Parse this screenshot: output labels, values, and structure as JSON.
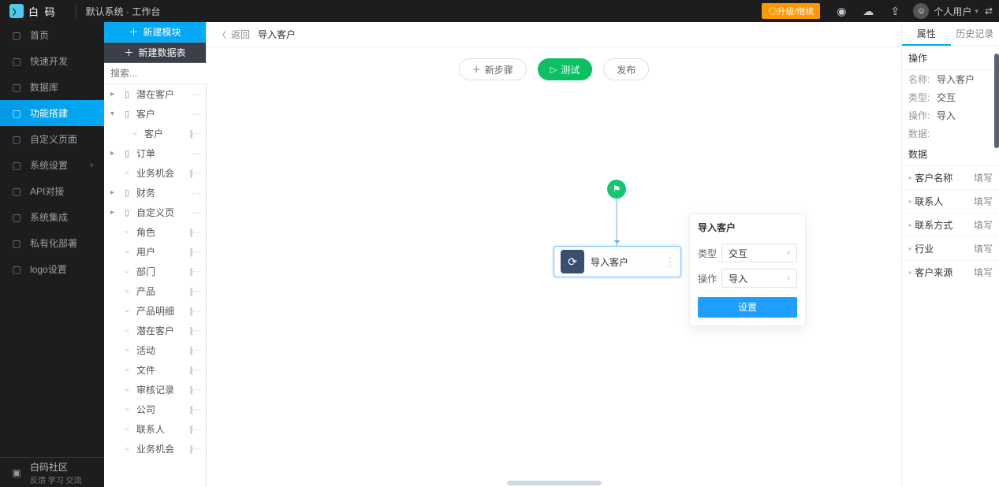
{
  "header": {
    "brand": "白 码",
    "system": "默认系统",
    "dot": "·",
    "workspace": "工作台",
    "upgrade": "◎升级/继续",
    "user": "个人用户"
  },
  "leftnav": {
    "items": [
      {
        "label": "首页",
        "icon": "home-icon"
      },
      {
        "label": "快速开发",
        "icon": "cube-icon"
      },
      {
        "label": "数据库",
        "icon": "database-icon"
      },
      {
        "label": "功能搭建",
        "icon": "module-icon",
        "active": true
      },
      {
        "label": "自定义页面",
        "icon": "page-icon"
      },
      {
        "label": "系统设置",
        "icon": "settings-icon",
        "chev": true
      },
      {
        "label": "API对接",
        "icon": "api-icon"
      },
      {
        "label": "系统集成",
        "icon": "integration-icon"
      },
      {
        "label": "私有化部署",
        "icon": "deploy-icon"
      },
      {
        "label": "logo设置",
        "icon": "logo-icon"
      }
    ],
    "community": {
      "title": "白码社区",
      "sub": "反馈 学习 交流"
    }
  },
  "treepanel": {
    "btn_new_module": "新建模块",
    "btn_new_table": "新建数据表",
    "search_placeholder": "搜索...",
    "rows": [
      {
        "type": "folder",
        "label": "潜在客户",
        "dots": true
      },
      {
        "type": "folder",
        "label": "客户",
        "expanded": true,
        "dots": true
      },
      {
        "type": "leaf",
        "label": "客户",
        "child": true,
        "bars": true
      },
      {
        "type": "folder",
        "label": "订单",
        "dots": true
      },
      {
        "type": "leaf",
        "label": "业务机会",
        "bars": true
      },
      {
        "type": "folder",
        "label": "财务",
        "dots": true
      },
      {
        "type": "folder",
        "label": "自定义页",
        "dots": true
      },
      {
        "type": "leaf",
        "label": "角色",
        "bars": true
      },
      {
        "type": "leaf",
        "label": "用户",
        "bars": true
      },
      {
        "type": "leaf",
        "label": "部门",
        "bars": true
      },
      {
        "type": "leaf",
        "label": "产品",
        "bars": true
      },
      {
        "type": "leaf",
        "label": "产品明细",
        "bars": true
      },
      {
        "type": "leaf",
        "label": "潜在客户",
        "bars": true
      },
      {
        "type": "leaf",
        "label": "活动",
        "bars": true
      },
      {
        "type": "leaf",
        "label": "文件",
        "bars": true
      },
      {
        "type": "leaf",
        "label": "审核记录",
        "bars": true
      },
      {
        "type": "leaf",
        "label": "公司",
        "bars": true
      },
      {
        "type": "leaf",
        "label": "联系人",
        "bars": true
      },
      {
        "type": "leaf",
        "label": "业务机会",
        "bars": true
      }
    ]
  },
  "breadcrumb": {
    "back": "返回",
    "title": "导入客户"
  },
  "toolbar": {
    "new_step": "新步骤",
    "test": "测试",
    "publish": "发布"
  },
  "flow": {
    "node": {
      "label": "导入客户"
    },
    "popup": {
      "title": "导入客户",
      "type_label": "类型",
      "type_value": "交互",
      "op_label": "操作",
      "op_value": "导入",
      "settings": "设置"
    }
  },
  "rightpanel": {
    "tab1": "属性",
    "tab2": "历史记录",
    "section_op": "操作",
    "kv": [
      {
        "k": "名称:",
        "v": "导入客户"
      },
      {
        "k": "类型:",
        "v": "交互"
      },
      {
        "k": "操作:",
        "v": "导入"
      },
      {
        "k": "数据:",
        "v": ""
      }
    ],
    "section_data": "数据",
    "drows": [
      {
        "label": "客户名称",
        "fill": "填写"
      },
      {
        "label": "联系人",
        "fill": "填写"
      },
      {
        "label": "联系方式",
        "fill": "填写"
      },
      {
        "label": "行业",
        "fill": "填写"
      },
      {
        "label": "客户来源",
        "fill": "填写"
      }
    ]
  }
}
